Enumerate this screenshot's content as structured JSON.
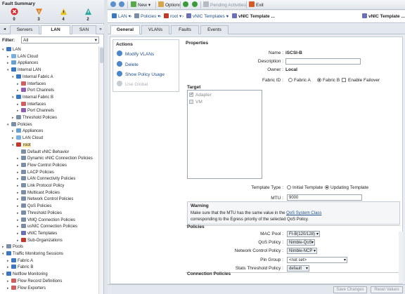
{
  "fault_summary": {
    "title": "Fault Summary",
    "counts": [
      "0",
      "3",
      "4",
      "2"
    ]
  },
  "left_tabs": [
    "Servers",
    "LAN",
    "SAN"
  ],
  "left_tab_arrows": {
    "prev": "◂",
    "next": "»"
  },
  "filter": {
    "label": "Filter:",
    "value": "All"
  },
  "tree": [
    "LAN",
    "LAN Cloud",
    "Appliances",
    "Internal LAN",
    "Internal Fabric A",
    "Interfaces",
    "Port Channels",
    "Internal Fabric B",
    "Interfaces",
    "Port Channels",
    "Threshold Policies",
    "Policies",
    "Appliances",
    "LAN Cloud",
    "root",
    "Default vNIC Behavior",
    "Dynamic vNIC Connection Policies",
    "Flow Control Policies",
    "LACP Policies",
    "LAN Connectivity Policies",
    "Link Protocol Policy",
    "Multicast Policies",
    "Network Control Policies",
    "QoS Policies",
    "Threshold Policies",
    "VMQ Connection Policies",
    "usNIC Connection Policies",
    "vNIC Templates",
    "Sub-Organizations",
    "Pools",
    "Traffic Monitoring Sessions",
    "Fabric A",
    "Fabric B",
    "Netflow Monitoring",
    "Flow Record Definitions",
    "Flow Exporters"
  ],
  "toolbar": {
    "new": "New",
    "options": "Options",
    "pending": "Pending Activities",
    "exit": "Exit"
  },
  "breadcrumb": {
    "lan": "LAN",
    "policies": "Policies",
    "root": "root",
    "vnic_templates": "vNIC Templates",
    "current": "vNIC Template ...",
    "right_title": "vNIC Template ..."
  },
  "right_tabs": [
    "General",
    "VLANs",
    "Faults",
    "Events"
  ],
  "actions": {
    "title": "Actions",
    "items": [
      "Modify VLANs",
      "Delete",
      "Show Policy Usage",
      "Use Global"
    ]
  },
  "properties": {
    "title": "Properties",
    "name_label": "Name :",
    "name_value": "iSCSI-B",
    "description_label": "Description :",
    "description_value": "",
    "owner_label": "Owner :",
    "owner_value": "Local",
    "fabric_label": "Fabric ID :",
    "fabric_a": "Fabric A",
    "fabric_b": "Fabric B",
    "enable_failover": "Enable Failover",
    "target_label": "Target",
    "target_adapter": "Adapter",
    "target_vm": "VM",
    "template_type_label": "Template Type :",
    "template_initial": "Initial Template",
    "template_updating": "Updating Template",
    "mtu_label": "MTU :",
    "mtu_value": "9000"
  },
  "warning": {
    "title": "Warning",
    "line1_a": "Make sure that the MTU has the same value in the ",
    "line1_link": "QoS System Class",
    "line2": "corresponding to the Egress priority of the selected QoS Policy."
  },
  "policies": {
    "title": "Policies",
    "mac_pool_label": "MAC Pool :",
    "mac_pool_value": "FI-B(120/128)",
    "qos_label": "QoS Policy :",
    "qos_value": "Nimble-QoS",
    "ncp_label": "Network Control Policy :",
    "ncp_value": "Nimble-NCP",
    "pin_label": "Pin Group :",
    "pin_value": "<not set>",
    "stats_label": "Stats Threshold Policy :",
    "stats_value": "default"
  },
  "connection_policies": {
    "title": "Connection Policies"
  },
  "buttons": {
    "save": "Save Changes",
    "reset": "Reset Values"
  },
  "colors": {
    "critical": "#d9262b",
    "major": "#e57a20",
    "minor": "#e8c31a",
    "warning": "#2aa8a0",
    "link": "#1d4e89"
  }
}
